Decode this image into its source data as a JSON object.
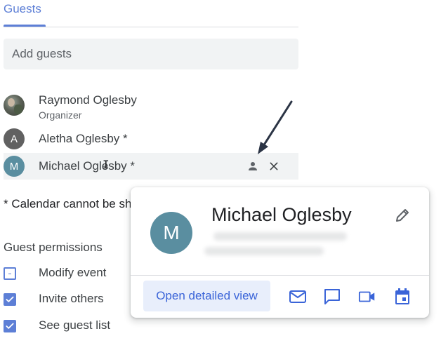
{
  "tab": {
    "label": "Guests"
  },
  "add_guests": {
    "placeholder": "Add guests"
  },
  "guests": [
    {
      "name": "Raymond Oglesby",
      "role": "Organizer"
    },
    {
      "name": "Aletha Oglesby *",
      "initial": "A"
    },
    {
      "name": "Michael Oglesby *",
      "initial": "M"
    }
  ],
  "footnote": "* Calendar cannot be sh",
  "permissions": {
    "heading": "Guest permissions",
    "items": [
      {
        "label": "Modify event",
        "checked": false
      },
      {
        "label": "Invite others",
        "checked": true
      },
      {
        "label": "See guest list",
        "checked": true
      }
    ]
  },
  "card": {
    "initial": "M",
    "name": "Michael Oglesby",
    "open_label": "Open detailed view",
    "actions": [
      "mail-icon",
      "chat-icon",
      "video-icon",
      "calendar-icon"
    ]
  },
  "colors": {
    "accent": "#5d7fd6",
    "button_text": "#3a64d8",
    "avatar_teal": "#5a8ea0",
    "avatar_gray": "#616161"
  }
}
